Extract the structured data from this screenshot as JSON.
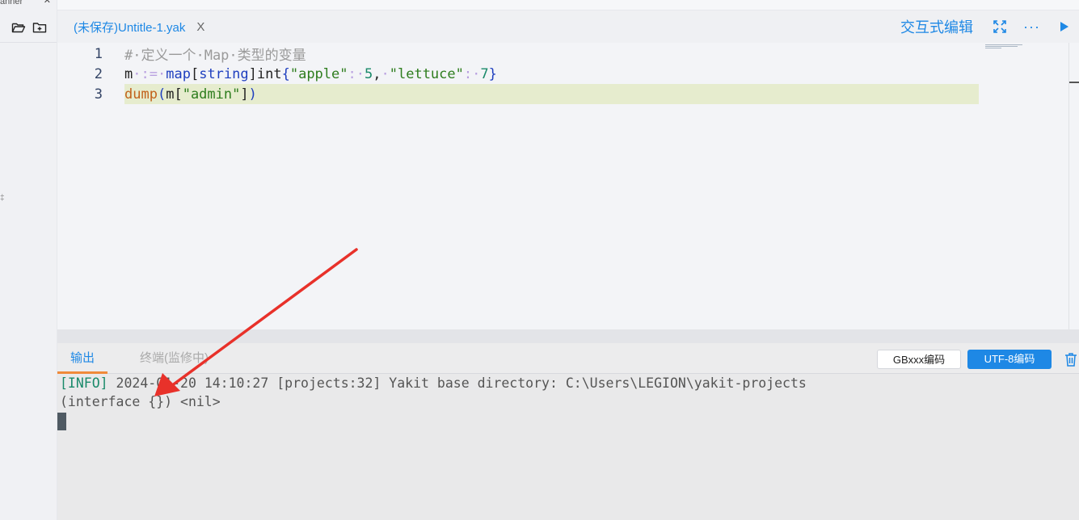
{
  "sidebar": {
    "top_tab_partial": "anner",
    "top_tab_close": "✕",
    "icons": [
      "folder-open-icon",
      "folder-add-icon"
    ],
    "edge_mark": "‡"
  },
  "tabbar": {
    "file_tab_label": "(未保存)Untitle-1.yak",
    "file_tab_close": "X",
    "interactive_edit": "交互式编辑",
    "more": "···",
    "icons": [
      "fullscreen-icon",
      "more-icon",
      "run-icon"
    ],
    "accent_color": "#1e88e5"
  },
  "editor": {
    "lines": [
      {
        "number": "1",
        "tokens": [
          {
            "t": "#·定义一个·Map·类型的变量",
            "c": "comment"
          }
        ]
      },
      {
        "number": "2",
        "tokens": [
          {
            "t": "m",
            "c": "var"
          },
          {
            "t": "·",
            "c": "ws"
          },
          {
            "t": ":=",
            "c": "ws"
          },
          {
            "t": "·",
            "c": "ws"
          },
          {
            "t": "map",
            "c": "kw"
          },
          {
            "t": "[",
            "c": "punc"
          },
          {
            "t": "string",
            "c": "type"
          },
          {
            "t": "]",
            "c": "punc"
          },
          {
            "t": "int",
            "c": "var"
          },
          {
            "t": "{",
            "c": "kw"
          },
          {
            "t": "\"apple\"",
            "c": "str"
          },
          {
            "t": ":",
            "c": "ws"
          },
          {
            "t": "·",
            "c": "ws"
          },
          {
            "t": "5",
            "c": "num"
          },
          {
            "t": ",",
            "c": "punc"
          },
          {
            "t": "·",
            "c": "ws"
          },
          {
            "t": "\"lettuce\"",
            "c": "str"
          },
          {
            "t": ":",
            "c": "ws"
          },
          {
            "t": "·",
            "c": "ws"
          },
          {
            "t": "7",
            "c": "num"
          },
          {
            "t": "}",
            "c": "kw"
          }
        ]
      },
      {
        "number": "3",
        "active": true,
        "tokens": [
          {
            "t": "dump",
            "c": "fn"
          },
          {
            "t": "(",
            "c": "kw"
          },
          {
            "t": "m",
            "c": "var"
          },
          {
            "t": "[",
            "c": "punc"
          },
          {
            "t": "\"admin\"",
            "c": "str"
          },
          {
            "t": "]",
            "c": "punc"
          },
          {
            "t": ")",
            "c": "kw"
          }
        ]
      }
    ],
    "active_line_color": "#e6ecce"
  },
  "panel": {
    "tabs": [
      {
        "label": "输出",
        "active": true
      },
      {
        "label": "终端(监修中)",
        "active": false
      }
    ],
    "encoding_gb": "GBxxx编码",
    "encoding_utf8": "UTF-8编码",
    "active_tab_underline_color": "#f08a3a"
  },
  "console": {
    "info_tag": "[INFO]",
    "info_message": " 2024-01-20 14:10:27 [projects:32] Yakit base directory: C:\\Users\\LEGION\\yakit-projects",
    "result_line": "(interface {}) <nil>"
  },
  "annotation": {
    "arrow_color": "#e8312a"
  }
}
